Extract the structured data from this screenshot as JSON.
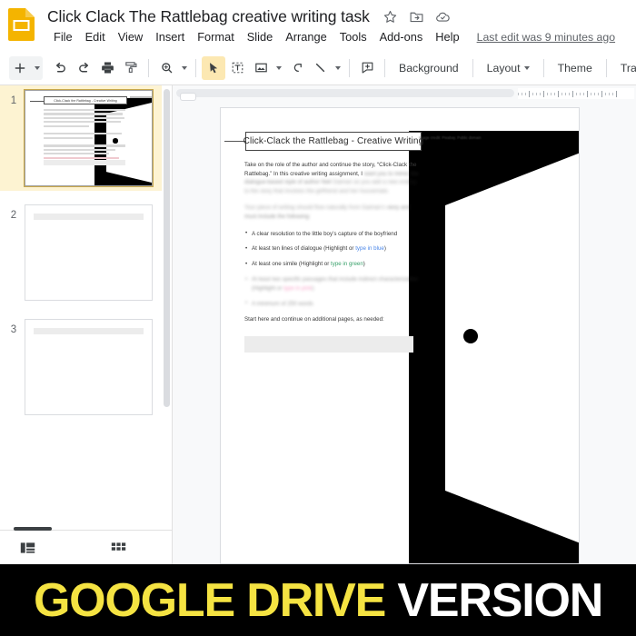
{
  "app": {
    "logo_icon": "google-slides-logo",
    "doc_title": "Click Clack The Rattlebag creative writing task",
    "title_icons": [
      "star-icon",
      "move-to-folder-icon",
      "cloud-saved-icon"
    ],
    "last_edit": "Last edit was 9 minutes ago"
  },
  "menubar": {
    "items": [
      {
        "label": "File"
      },
      {
        "label": "Edit"
      },
      {
        "label": "View"
      },
      {
        "label": "Insert"
      },
      {
        "label": "Format"
      },
      {
        "label": "Slide"
      },
      {
        "label": "Arrange"
      },
      {
        "label": "Tools"
      },
      {
        "label": "Add-ons"
      },
      {
        "label": "Help"
      }
    ]
  },
  "toolbar": {
    "new_slide_icon": "plus-icon",
    "new_slide_caret": "chevron-down-icon",
    "undo_icon": "undo-icon",
    "redo_icon": "redo-icon",
    "print_icon": "print-icon",
    "paint_format_icon": "paint-format-icon",
    "zoom_icon": "zoom-icon",
    "zoom_caret": "chevron-down-icon",
    "select_icon": "cursor-select-icon",
    "textbox_icon": "text-box-icon",
    "image_icon": "image-icon",
    "image_caret": "chevron-down-icon",
    "shape_icon": "shape-icon",
    "line_icon": "line-icon",
    "line_caret": "chevron-down-icon",
    "comment_icon": "add-comment-icon",
    "background_label": "Background",
    "layout_label": "Layout",
    "layout_caret": "chevron-down-icon",
    "theme_label": "Theme",
    "transition_label": "Transition"
  },
  "filmstrip": {
    "slides": [
      {
        "number": "1",
        "selected": true
      },
      {
        "number": "2",
        "selected": false
      },
      {
        "number": "3",
        "selected": false
      }
    ],
    "bottom": {
      "filmstrip_view_icon": "filmstrip-view-icon",
      "grid_view_icon": "grid-view-icon"
    }
  },
  "slide": {
    "title": "Click-Clack the Rattlebag  -  Creative Writing",
    "image_credit": "Image credit: Pixabay, Public domain",
    "paragraphs": [
      {
        "clear": "Take on the role of the author and continue the story, “Click-Clack the Rattlebag.” In this creative writing assignment, I",
        "blur_1": "want you to mimic the dialogue-based style of author Neil",
        "blur_2": "Gaiman as you add a new ending to the story that involves the girlfriend and her housemate."
      },
      {
        "blur_1": "Your piece of writing should flow naturally from Gaiman’s",
        "blur_2": "story and must include the following:"
      }
    ],
    "bullets": [
      {
        "text": "A clear resolution to the little boy’s capture of the boyfriend",
        "blurred": false
      },
      {
        "text_before": "At least ten lines of dialogue (Highlight or ",
        "highlight": "type in blue",
        "highlight_color": "blue",
        "text_after": ")",
        "blurred": false
      },
      {
        "text_before": "At least one simile (Highlight or ",
        "highlight": "type in green",
        "highlight_color": "green",
        "text_after": ")",
        "blurred": false
      },
      {
        "text_before": "At least two specific passages that include indirect characterization (Highlight or ",
        "highlight": "type in pink",
        "highlight_color": "pink",
        "text_after": ")",
        "blurred": true
      },
      {
        "text": "A minimum of 250 words",
        "blurred": true
      }
    ],
    "start_text": "Start here and continue on additional pages, as needed:",
    "artwork": {
      "name": "open-door-illustration",
      "background_color": "#000000",
      "panel_color": "#ffffff",
      "knob_color": "#000000"
    }
  },
  "banner": {
    "text_primary": "GOOGLE DRIVE",
    "text_secondary": "VERSION",
    "primary_color": "#f5e342",
    "secondary_color": "#ffffff",
    "background_color": "#000000"
  }
}
